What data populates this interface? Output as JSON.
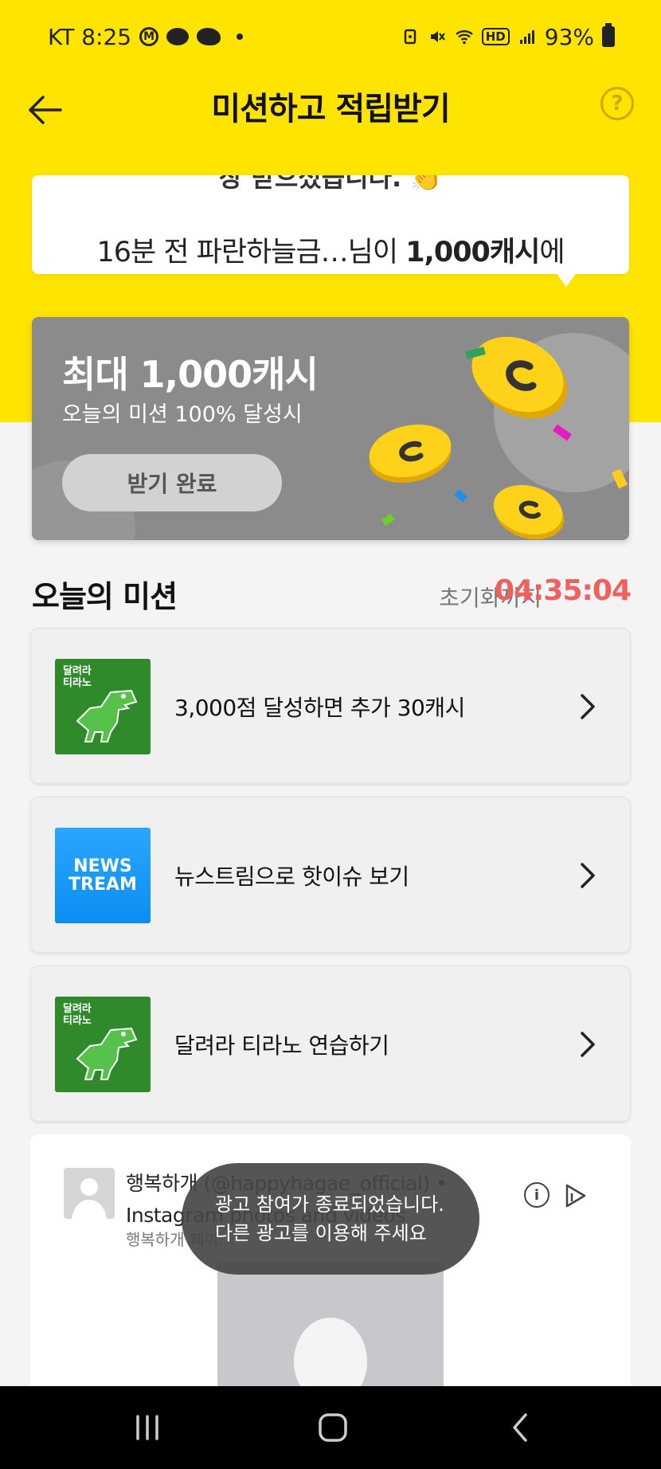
{
  "status_bar": {
    "carrier_time": "KT 8:25",
    "network_badge": "HD",
    "battery": "93%",
    "icons": [
      "m-circle-icon",
      "talk-icon",
      "talk2-icon",
      "dot-icon",
      "vibrate-icon",
      "mute-icon",
      "wifi-icon",
      "hd-icon",
      "signal-icon",
      "battery-icon"
    ]
  },
  "app_bar": {
    "title": "미션하고 적립받기",
    "back_icon": "arrow-left-icon",
    "help_icon": "question-circle-icon",
    "help_glyph": "?"
  },
  "ticker": {
    "previous_text": "장 받으셨습니다. 👏",
    "prefix": "16분 전 파란하늘금…님이 ",
    "amount": "1,000캐시",
    "suffix": "에"
  },
  "banner": {
    "title": "최대 1,000캐시",
    "subtitle": "오늘의 미션 100% 달성시",
    "button_label": "받기 완료",
    "coin_color": "#ffd21a",
    "background": "#8b8b8b"
  },
  "missions_section": {
    "title": "오늘의 미션",
    "reset_label": "초기화까지",
    "reset_timer": "04:35:04",
    "timer_color": "#f0605d"
  },
  "missions": [
    {
      "label": "3,000점 달성하면 추가 30캐시",
      "thumb": "dino",
      "thumb_text": "달려라\n티라노"
    },
    {
      "label": "뉴스트림으로 핫이슈 보기",
      "thumb": "newstream",
      "thumb_text": "NEWS\nTREAM"
    },
    {
      "label": "달려라 티라노 연습하기",
      "thumb": "dino",
      "thumb_text": "달려라\n티라노"
    }
  ],
  "ad": {
    "title": "행복하개 (@happyhagae_official) • Instagram photos and videos",
    "subtitle": "행복하개 페이...",
    "info_glyph": "i"
  },
  "toast": {
    "line1": "광고 참여가 종료되었습니다.",
    "line2": "다른 광고를 이용해 주세요"
  },
  "nav_bar": {
    "buttons": [
      "recents-icon",
      "home-icon",
      "back-icon"
    ]
  }
}
